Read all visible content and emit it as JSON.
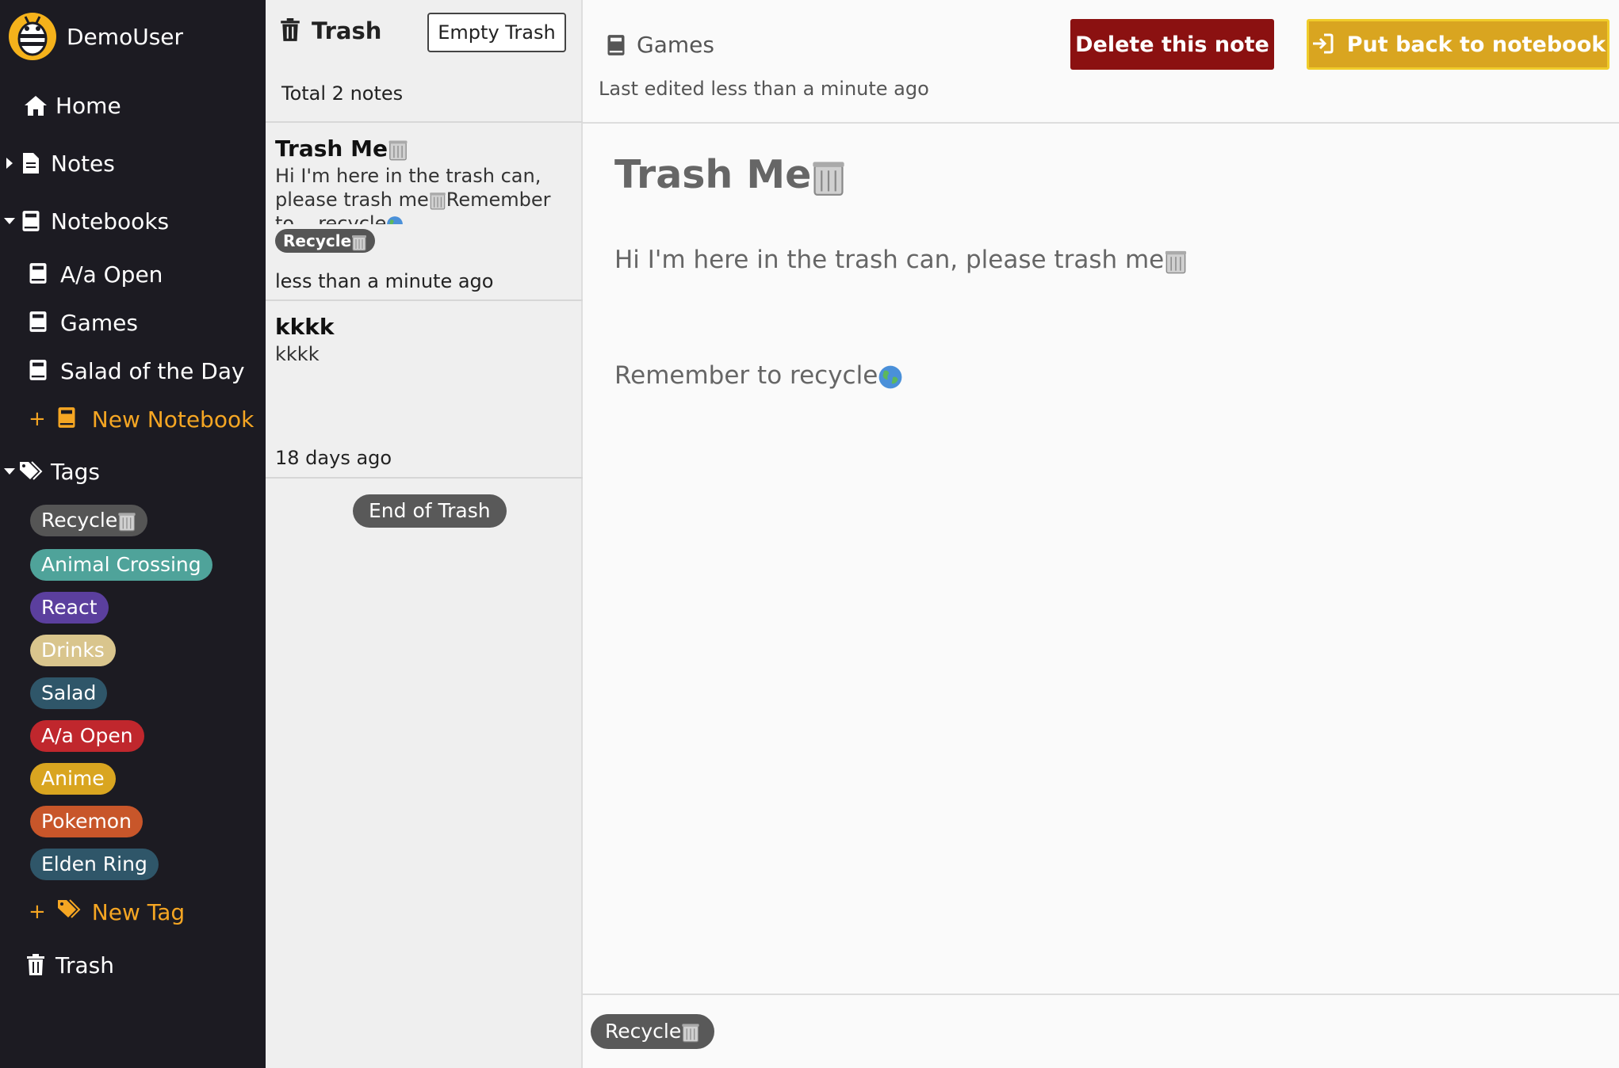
{
  "sidebar": {
    "user_name": "DemoUser",
    "home_label": "Home",
    "notes_label": "Notes",
    "notebooks_label": "Notebooks",
    "notebooks": [
      "A/a Open",
      "Games",
      "Salad of the Day"
    ],
    "new_notebook_label": "New Notebook",
    "tags_label": "Tags",
    "tags": [
      {
        "label": "Recycle",
        "color": "#555555"
      },
      {
        "label": "Animal Crossing",
        "color": "#4fa39a"
      },
      {
        "label": "React",
        "color": "#5b3f9e"
      },
      {
        "label": "Drinks",
        "color": "#d9c58d"
      },
      {
        "label": "Salad",
        "color": "#2f5669"
      },
      {
        "label": "A/a Open",
        "color": "#c0272d"
      },
      {
        "label": "Anime",
        "color": "#d9a520"
      },
      {
        "label": "Pokemon",
        "color": "#c8562a"
      },
      {
        "label": "Elden Ring",
        "color": "#2f5669"
      }
    ],
    "new_tag_label": "New Tag",
    "trash_label": "Trash",
    "accent_color": "#f5a623"
  },
  "list": {
    "title": "Trash",
    "empty_button": "Empty Trash",
    "total": "Total 2 notes",
    "notes": [
      {
        "title": "Trash Me",
        "preview": "Hi I'm here in the trash can, please trash me",
        "preview_tail": "Remember to...",
        "preview_overflow": "recycle",
        "tag": "Recycle",
        "date": "less than a minute ago"
      },
      {
        "title": "kkkk",
        "preview": "kkkk",
        "date": "18 days ago"
      }
    ],
    "end_label": "End of Trash"
  },
  "main": {
    "notebook": "Games",
    "edited": "Last edited less than a minute ago",
    "delete_button": "Delete this note",
    "putback_button": "Put back to notebook",
    "note_title": "Trash Me",
    "line1": "Hi I'm here in the trash can, please trash me",
    "line2": "Remember to recycle",
    "footer_tag": "Recycle",
    "delete_color": "#8b1111",
    "putback_color": "#d9a520"
  }
}
